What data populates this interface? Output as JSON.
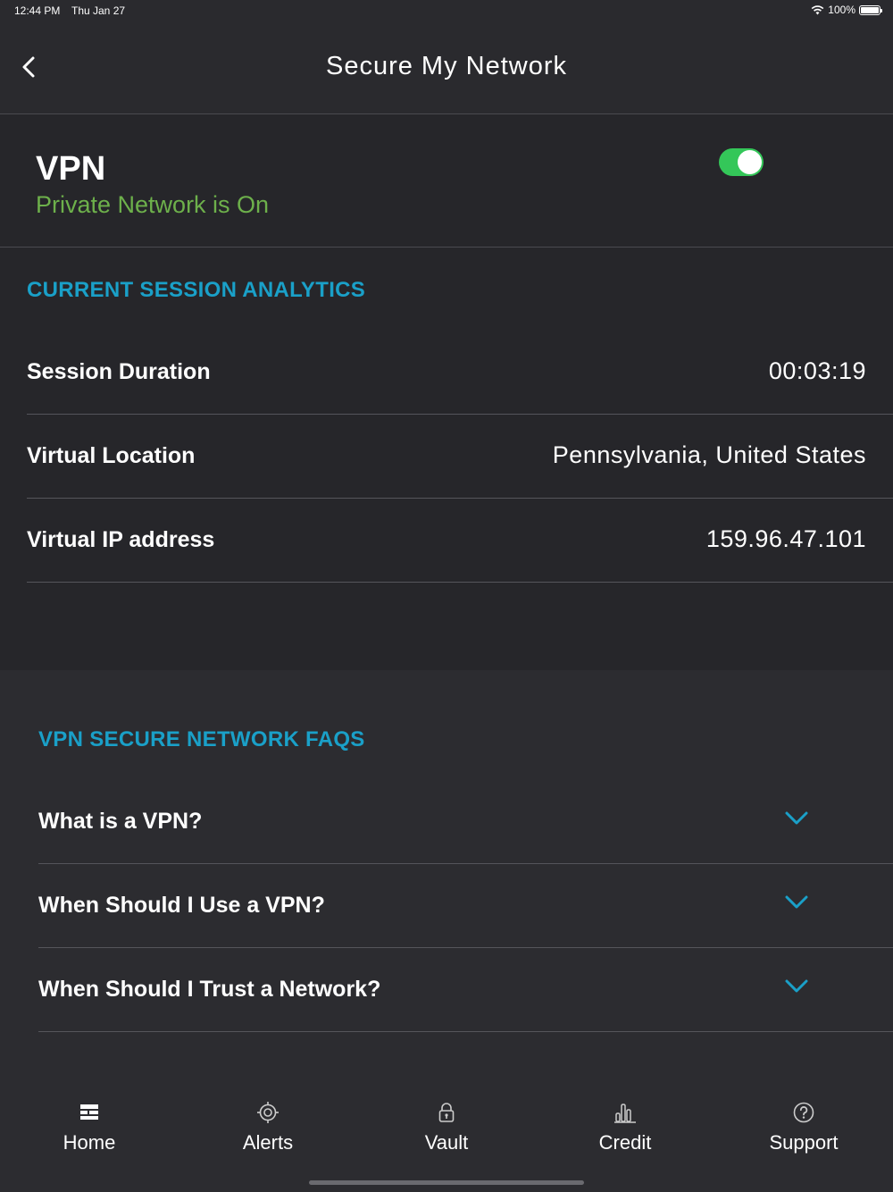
{
  "status_bar": {
    "time": "12:44 PM",
    "date": "Thu Jan 27",
    "battery": "100%"
  },
  "header": {
    "title": "Secure My Network",
    "back_icon": "chevron-left-icon"
  },
  "vpn": {
    "title": "VPN",
    "status": "Private Network is On",
    "toggle_on": true,
    "status_color": "#6db04b",
    "toggle_color": "#34c759"
  },
  "analytics": {
    "heading": "CURRENT SESSION ANALYTICS",
    "rows": [
      {
        "label": "Session Duration",
        "value": "00:03:19"
      },
      {
        "label": "Virtual Location",
        "value": "Pennsylvania, United States"
      },
      {
        "label": "Virtual IP address",
        "value": "159.96.47.101"
      }
    ]
  },
  "faq": {
    "heading": "VPN SECURE NETWORK FAQS",
    "items": [
      {
        "label": "What is a VPN?"
      },
      {
        "label": "When Should I Use a VPN?"
      },
      {
        "label": "When Should I Trust a Network?"
      }
    ],
    "accent_color": "#1aa0c8"
  },
  "tabbar": {
    "tabs": [
      {
        "label": "Home",
        "icon": "home-icon"
      },
      {
        "label": "Alerts",
        "icon": "alerts-icon"
      },
      {
        "label": "Vault",
        "icon": "lock-icon"
      },
      {
        "label": "Credit",
        "icon": "bar-chart-icon"
      },
      {
        "label": "Support",
        "icon": "help-icon"
      }
    ]
  }
}
